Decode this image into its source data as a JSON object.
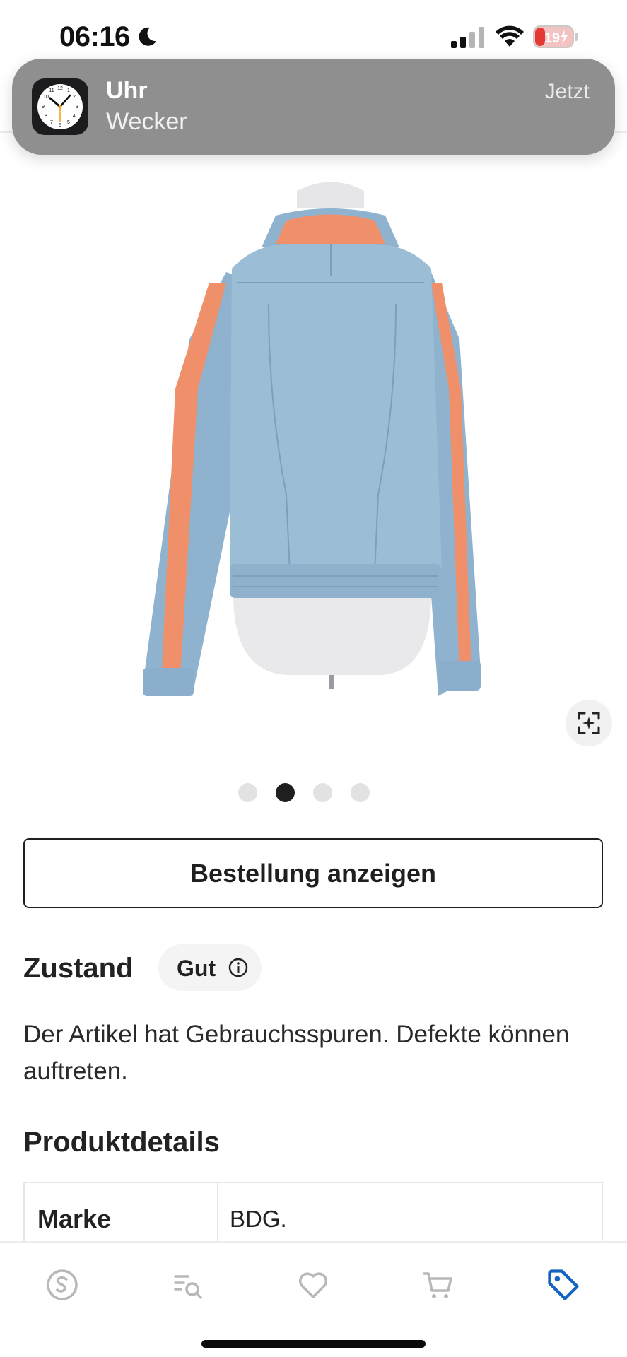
{
  "status_bar": {
    "time": "06:16",
    "battery_level": "19"
  },
  "notification": {
    "app": "Uhr",
    "subtitle": "Wecker",
    "time": "Jetzt"
  },
  "gallery": {
    "total_images": 4,
    "active_index": 1
  },
  "order_button_label": "Bestellung anzeigen",
  "condition": {
    "heading": "Zustand",
    "badge": "Gut",
    "description": "Der Artikel hat Gebrauchsspuren. Defekte können auftreten."
  },
  "product_details": {
    "heading": "Produktdetails",
    "rows": [
      {
        "key": "Marke",
        "value": "BDG."
      }
    ]
  },
  "tabbar": {
    "active": "sell-tag-icon",
    "colors": {
      "active": "#1565c0",
      "inactive": "#b8b8b8"
    }
  },
  "colors": {
    "notification_bg": "#8f8f8f",
    "battery_low": "#e53935",
    "text": "#1f1f1f"
  }
}
